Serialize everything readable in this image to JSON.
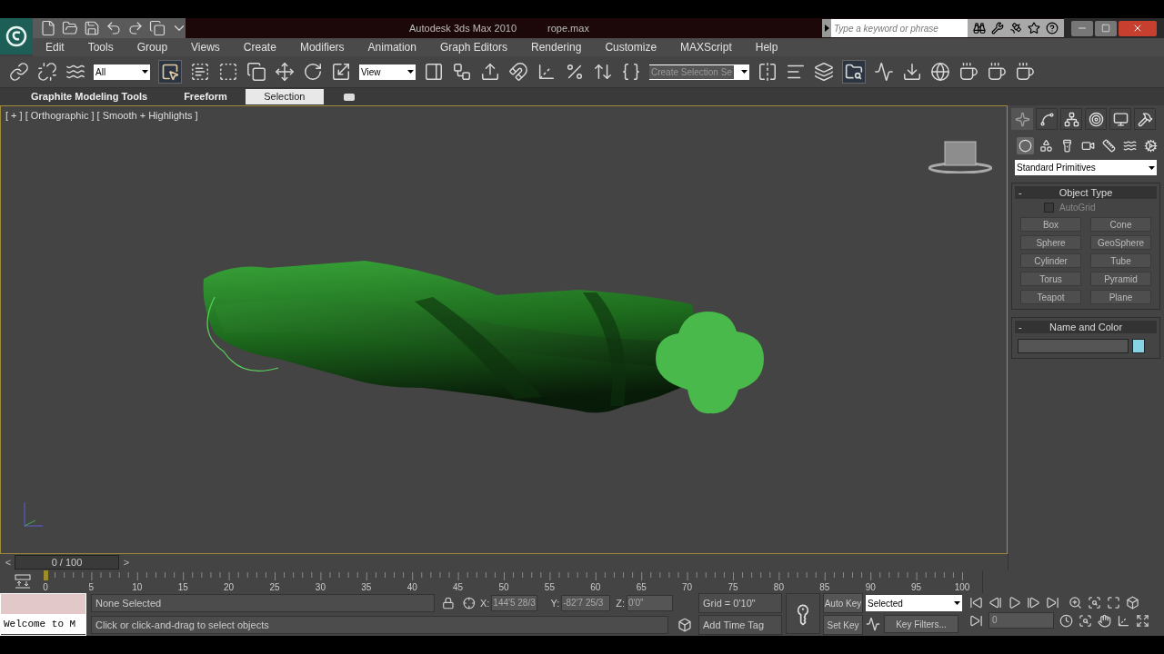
{
  "title_bar": {
    "app": "Autodesk 3ds Max  2010",
    "file": "rope.max",
    "search": {
      "placeholder": "Type a keyword or phrase"
    }
  },
  "menu": [
    "Edit",
    "Tools",
    "Group",
    "Views",
    "Create",
    "Modifiers",
    "Animation",
    "Graph Editors",
    "Rendering",
    "Customize",
    "MAXScript",
    "Help"
  ],
  "toolbar": {
    "selection_filter": "All",
    "reference_coord": "View",
    "named_selection": "Create Selection Se"
  },
  "ribbon_tabs": [
    {
      "label": "Graphite Modeling Tools",
      "selected": false
    },
    {
      "label": "Freeform",
      "selected": false
    },
    {
      "label": "Selection",
      "selected": true
    }
  ],
  "viewport": {
    "label": "[ + ] [ Orthographic ] [ Smooth + Highlights ]"
  },
  "command_panel": {
    "tabs": [
      {
        "selected": true
      },
      {
        "selected": false
      },
      {
        "selected": false
      },
      {
        "selected": false
      },
      {
        "selected": false
      },
      {
        "selected": false
      }
    ],
    "categories": [
      {
        "selected": true
      },
      {
        "selected": false
      },
      {
        "selected": false
      },
      {
        "selected": false
      },
      {
        "selected": false
      },
      {
        "selected": false
      },
      {
        "selected": false
      }
    ],
    "dropdown": "Standard Primitives",
    "rollouts": [
      {
        "kind": "object_type",
        "collapse": "-",
        "title": "Object Type",
        "autogrid": {
          "label": "AutoGrid",
          "checked": false
        },
        "buttons": [
          "Box",
          "Cone",
          "Sphere",
          "GeoSphere",
          "Cylinder",
          "Tube",
          "Torus",
          "Pyramid",
          "Teapot",
          "Plane"
        ]
      },
      {
        "kind": "name_color",
        "collapse": "-",
        "title": "Name and Color",
        "color": "#87d3e6"
      }
    ]
  },
  "time_slider": {
    "prev": "<",
    "label": "0 / 100",
    "next": ">",
    "level": 0
  },
  "track_bar": {
    "labels": [
      "0",
      "5",
      "10",
      "15",
      "20",
      "25",
      "30",
      "35",
      "40",
      "45",
      "50",
      "55",
      "60",
      "65",
      "70",
      "75",
      "80",
      "85",
      "90",
      "95",
      "100"
    ]
  },
  "status": {
    "listener": "Welcome to M",
    "selection": "None Selected",
    "prompt": "Click or click-and-drag to select objects",
    "x": {
      "label": "X:",
      "value": "144'5 28/3"
    },
    "y": {
      "label": "Y:",
      "value": "-82'7 25/3"
    },
    "z": {
      "label": "Z:",
      "value": "0'0\""
    },
    "grid": "Grid = 0'10\"",
    "time_tag": "Add Time Tag",
    "auto_key": "Auto Key",
    "key_mode": "Selected",
    "set_key": "Set Key",
    "key_filters": "Key Filters...",
    "frame": "0"
  }
}
